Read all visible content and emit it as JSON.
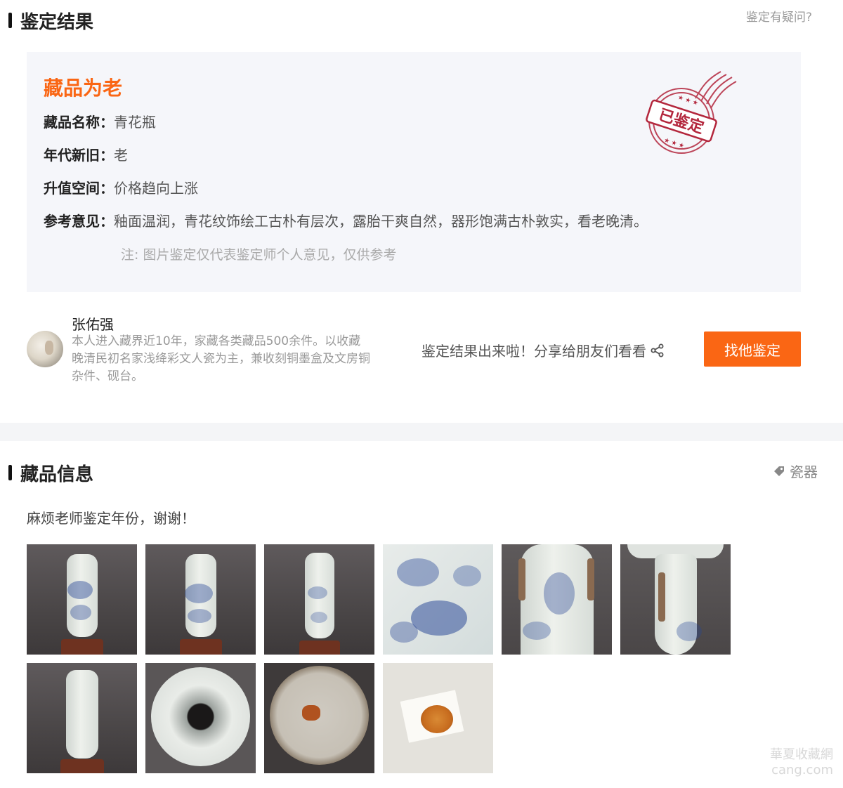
{
  "result": {
    "section_title": "鉴定结果",
    "doubt_link": "鉴定有疑问?",
    "verdict": "藏品为老",
    "stamp_text": "已鉴定",
    "fields": [
      {
        "label": "藏品名称：",
        "value": "青花瓶"
      },
      {
        "label": "年代新旧：",
        "value": "老"
      },
      {
        "label": "升值空间：",
        "value": "价格趋向上涨"
      },
      {
        "label": "参考意见：",
        "value": "釉面温润，青花纹饰绘工古朴有层次，露胎干爽自然，器形饱满古朴敦实，看老晚清。"
      }
    ],
    "note": "注: 图片鉴定仅代表鉴定师个人意见，仅供参考"
  },
  "expert": {
    "name": "张佑强",
    "description": "本人进入藏界近10年，家藏各类藏品500余件。以收藏晚清民初名家浅绛彩文人瓷为主，兼收刻铜墨盒及文房铜杂件、砚台。",
    "share_text": "鉴定结果出来啦！分享给朋友们看看",
    "button_label": "找他鉴定"
  },
  "collection": {
    "section_title": "藏品信息",
    "tag": "瓷器",
    "description": "麻烦老师鉴定年份，谢谢！",
    "images": [
      "vase-front",
      "vase-side",
      "vase-back",
      "kylin-closeup",
      "phoenix-handle-closeup",
      "neck-closeup",
      "vase-plain-side",
      "mouth-interior",
      "base-bottom",
      "base-seal-closeup"
    ]
  },
  "watermark": {
    "line1": "華夏收藏網",
    "line2": "cang.com"
  },
  "colors": {
    "accent": "#fa6614",
    "stamp": "#b3263c",
    "panel_bg": "#f5f6fa"
  },
  "icons": {
    "share": "share-icon",
    "tag": "tag-icon"
  }
}
